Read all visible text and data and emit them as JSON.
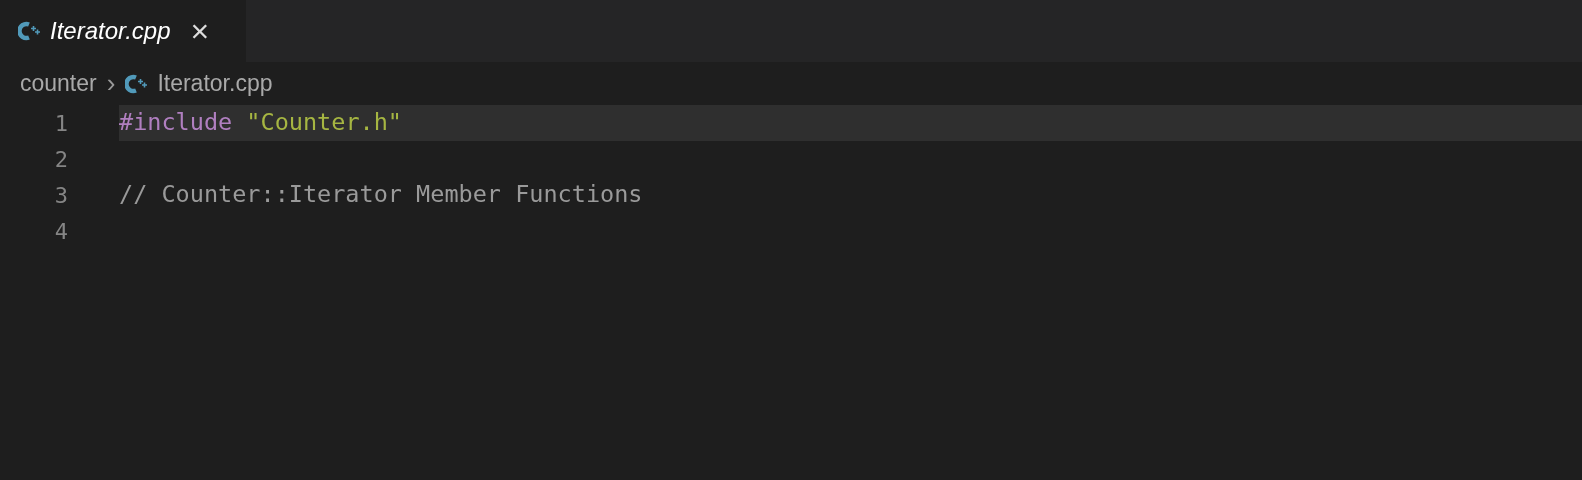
{
  "tabs": [
    {
      "label": "Iterator.cpp",
      "selected": true,
      "preview": true,
      "close": "×"
    }
  ],
  "breadcrumbs": [
    {
      "label": "counter",
      "kind": "folder"
    },
    {
      "label": "Iterator.cpp",
      "kind": "file"
    }
  ],
  "separator": "›",
  "lines": [
    {
      "number": "1",
      "current": true,
      "tokens": [
        {
          "text": "#include ",
          "kind": "keyword"
        },
        {
          "text": "\"Counter.h\"",
          "kind": "string"
        }
      ]
    },
    {
      "number": "2",
      "current": false
    },
    {
      "number": "3",
      "current": false,
      "tokens": [
        {
          "text": "// Counter::Iterator Member Functions",
          "kind": "comment"
        }
      ]
    },
    {
      "number": "4",
      "current": false
    }
  ]
}
